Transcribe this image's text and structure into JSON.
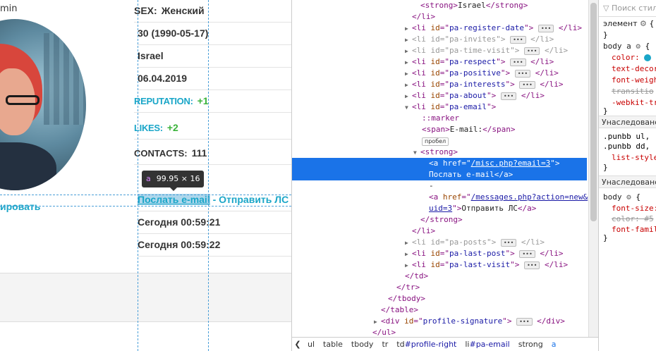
{
  "page": {
    "admin_fragment": "min",
    "left_link_fragment": "ировать",
    "rows": {
      "sex_label": "SEX:",
      "sex_value": "Женский",
      "age": "30 (1990-05-17)",
      "country": "Israel",
      "register_date": "06.04.2019",
      "reputation_label": "REPUTATION:",
      "reputation_value": "+1",
      "likes_label": "LIKES:",
      "likes_value": "+2",
      "contacts_label": "CONTACTS:",
      "contacts_value": "111",
      "email_link": "Послать e-mail",
      "email_sep": " - ",
      "pm_link": "Отправить ЛС",
      "last_post": "Сегодня 00:59:21",
      "last_visit": "Сегодня 00:59:22"
    },
    "tooltip": {
      "tag": "a",
      "size": "99.95 × 16"
    }
  },
  "devtools": {
    "lines": {
      "l0": {
        "open": "<strong>",
        "text": "Israel",
        "close": "</strong>"
      },
      "l1": {
        "tag": "</li>"
      },
      "l2": {
        "id": "pa-register-date"
      },
      "l3": {
        "id": "pa-invites"
      },
      "l4": {
        "id": "pa-time-visit"
      },
      "l5": {
        "id": "pa-respect"
      },
      "l6": {
        "id": "pa-positive"
      },
      "l7": {
        "id": "pa-interests"
      },
      "l8": {
        "id": "pa-about"
      },
      "l9": {
        "id": "pa-email"
      },
      "l10": {
        "text": "::marker"
      },
      "l11": {
        "open": "<span>",
        "text": "E-mail:",
        "close": "</span>"
      },
      "l12": {
        "text": "пробел"
      },
      "l13": {
        "tag": "<strong>"
      },
      "l14": {
        "href": "/misc.php?email=3"
      },
      "l15": {
        "text": "Послать e-mail",
        "close": "</a>"
      },
      "l16": {
        "text": "-"
      },
      "l17": {
        "href": "/messages.php?action=new&"
      },
      "l18": {
        "href_cont": "uid=3",
        "text": "Отправить ЛС",
        "close": "</a>"
      },
      "l19": {
        "tag": "</strong>"
      },
      "l20": {
        "tag": "</li>"
      },
      "l21": {
        "id": "pa-posts"
      },
      "l22": {
        "id": "pa-last-post"
      },
      "l23": {
        "id": "pa-last-visit"
      },
      "l24": {
        "tag": "</td>"
      },
      "l25": {
        "tag": "</tr>"
      },
      "l26": {
        "tag": "</tbody>"
      },
      "l27": {
        "tag": "</table>"
      },
      "l28": {
        "id": "profile-signature"
      },
      "l29": {
        "tag": "</ul>"
      }
    },
    "dots": "•••",
    "breadcrumbs": {
      "ul": "ul",
      "table": "table",
      "tbody": "tbody",
      "tr": "tr",
      "td": "td",
      "td_id": "#profile-right",
      "li": "li",
      "li_id": "#pa-email",
      "strong": "strong",
      "a": "a"
    }
  },
  "styles": {
    "filter_placeholder": "Поиск стил",
    "element_rule": "элемент",
    "body_a_selector": "body a",
    "body_a_props": {
      "color": "color:",
      "text_decor": "text-decor",
      "font_weight": "font-weigh",
      "transition": "transitio",
      "webkit": "-webkit-tr"
    },
    "inherited_1": "Унаследовано",
    "punbb_1": ".punbb ul, .p",
    "punbb_2": ".punbb dd, .p",
    "list_style": "list-style",
    "inherited_2": "Унаследовано",
    "body_selector": "body",
    "body_props": {
      "font_size": "font-size:",
      "color_struck": "color: #5",
      "font_family": "font-famil"
    },
    "accent_color": "#1aa6c8"
  }
}
